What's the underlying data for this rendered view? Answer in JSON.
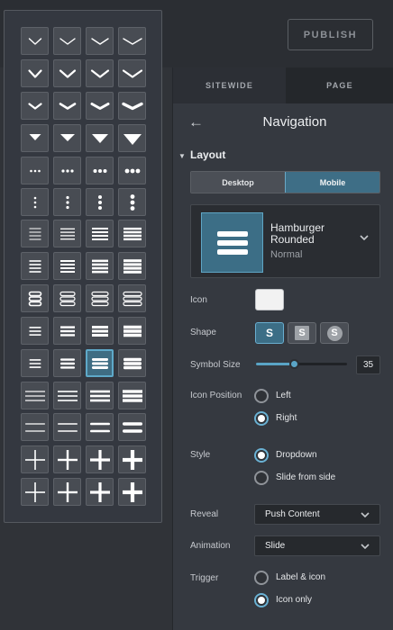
{
  "topbar": {
    "publish_label": "PUBLISH"
  },
  "panel": {
    "tabs": [
      {
        "label": "SITEWIDE"
      },
      {
        "label": "PAGE"
      }
    ],
    "back_glyph": "←",
    "title": "Navigation",
    "section_title": "Layout",
    "view_toggle": {
      "desktop": "Desktop",
      "mobile": "Mobile",
      "selected": "Mobile"
    },
    "preview": {
      "name": "Hamburger Rounded",
      "variant": "Normal"
    },
    "labels": {
      "icon": "Icon",
      "shape": "Shape",
      "symbol_size": "Symbol Size",
      "icon_position": "Icon Position",
      "style": "Style",
      "reveal": "Reveal",
      "animation": "Animation",
      "trigger": "Trigger"
    },
    "icon_color": "#f2f2f2",
    "shape_options": [
      {
        "letter": "S",
        "selected": true
      },
      {
        "letter": "S"
      },
      {
        "letter": "S"
      }
    ],
    "symbol_size": {
      "value": "35",
      "fraction": 0.42
    },
    "icon_position": {
      "options": [
        "Left",
        "Right"
      ],
      "selected": "Right"
    },
    "style": {
      "options": [
        "Dropdown",
        "Slide from side"
      ],
      "selected": "Dropdown"
    },
    "reveal": {
      "value": "Push Content"
    },
    "animation": {
      "value": "Slide"
    },
    "trigger": {
      "options": [
        "Label & icon",
        "Icon only"
      ],
      "selected": "Icon only"
    }
  },
  "picker": {
    "rows": [
      "chevron-thin",
      "chevron-medium",
      "chevron-wide",
      "triangle",
      "dots-horizontal",
      "dots-vertical",
      "bars-thin",
      "bars-medium",
      "bars-rounded-outline",
      "bars-compact",
      "bars-rounded",
      "lines-wide",
      "lines-wide-spaced",
      "plus",
      "plus-alt"
    ],
    "selected": {
      "row": 10,
      "col": 2
    }
  },
  "colors": {
    "accent": "#5aa4c6",
    "accent_fill": "#3c6e86",
    "panel_bg": "#353940",
    "picker_cell": "#484c53"
  }
}
